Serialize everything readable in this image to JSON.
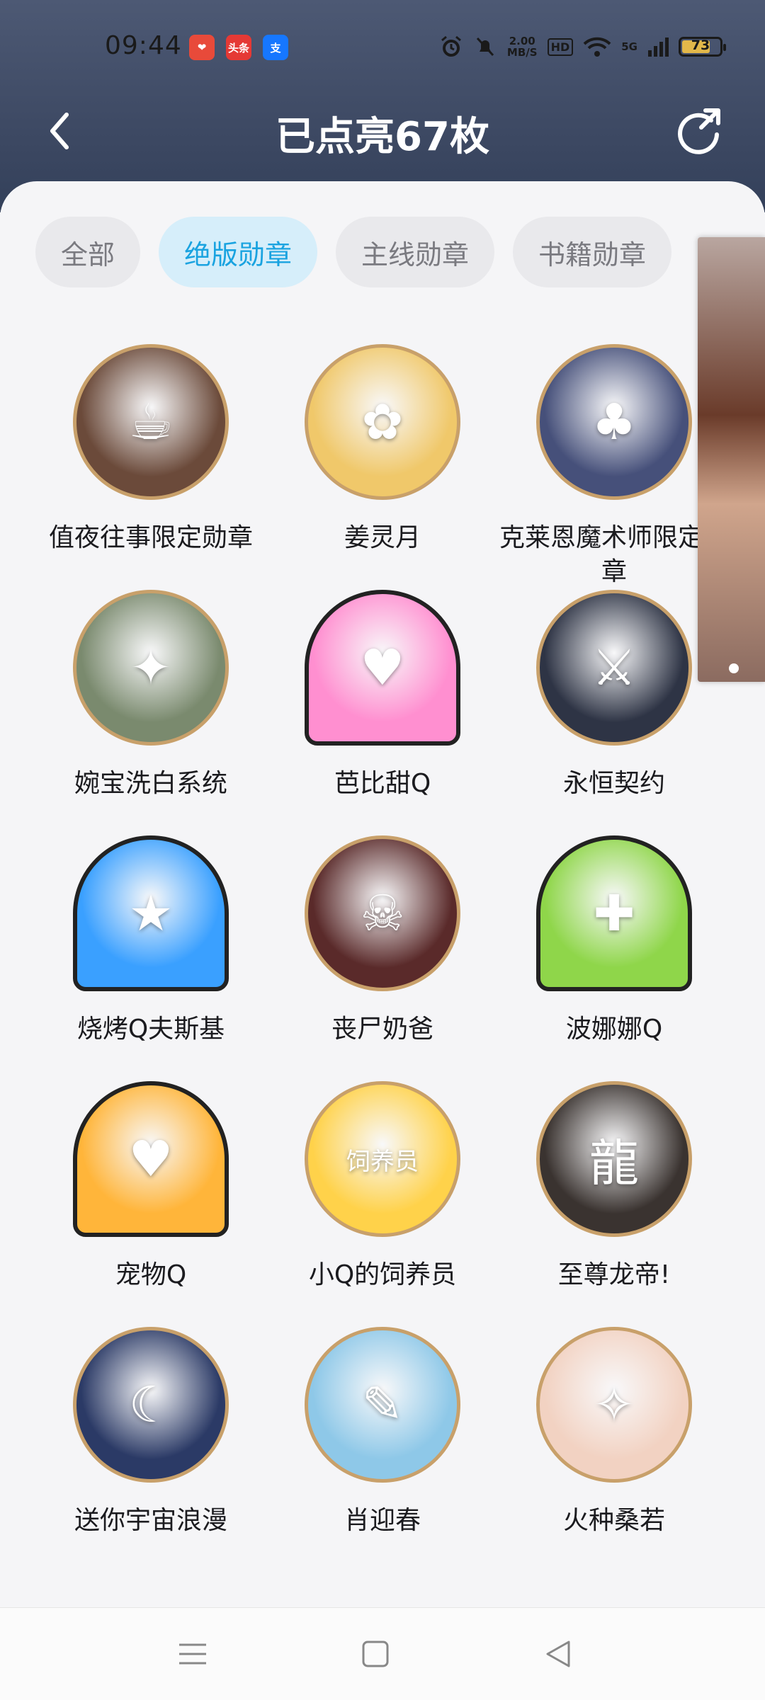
{
  "status_bar": {
    "time": "09:44",
    "apps": [
      {
        "name": "weather-app-icon",
        "text": "❤",
        "color": "#e84a3a"
      },
      {
        "name": "toutiao-app-icon",
        "text": "头条",
        "color": "#e53935"
      },
      {
        "name": "alipay-app-icon",
        "text": "支",
        "color": "#1677ff"
      }
    ],
    "net_speed_top": "2.00",
    "net_speed_bottom": "MB/S",
    "hd_label": "HD",
    "signal_label": "5G",
    "battery": "73"
  },
  "header": {
    "title": "已点亮67枚"
  },
  "tabs": [
    {
      "label": "全部",
      "active": false
    },
    {
      "label": "绝版勋章",
      "active": true
    },
    {
      "label": "主线勋章",
      "active": false
    },
    {
      "label": "书籍勋章",
      "active": false
    }
  ],
  "badges": [
    {
      "name": "值夜往事限定勋章",
      "glyph": "☕",
      "style": "circle",
      "bg": "#6b4a3a"
    },
    {
      "name": "姜灵月",
      "glyph": "✿",
      "style": "circle",
      "bg": "#f0c86a"
    },
    {
      "name": "克莱恩魔术师限定勋章",
      "glyph": "♣",
      "style": "circle",
      "bg": "#46507a"
    },
    {
      "name": "婉宝洗白系统",
      "glyph": "✦",
      "style": "circle",
      "bg": "#7a8a6e"
    },
    {
      "name": "芭比甜Q",
      "glyph": "♥",
      "style": "globe",
      "bg": "#ff8fd0"
    },
    {
      "name": "永恒契约",
      "glyph": "⚔",
      "style": "circle",
      "bg": "#2e3445"
    },
    {
      "name": "烧烤Q夫斯基",
      "glyph": "★",
      "style": "globe",
      "bg": "#3aa0ff"
    },
    {
      "name": "丧尸奶爸",
      "glyph": "☠",
      "style": "circle",
      "bg": "#5a2a2a"
    },
    {
      "name": "波娜娜Q",
      "glyph": "✚",
      "style": "globe",
      "bg": "#8fd64a"
    },
    {
      "name": "宠物Q",
      "glyph": "♥",
      "style": "globe",
      "bg": "#ffb53a"
    },
    {
      "name": "小Q的饲养员",
      "glyph": "饲养员",
      "style": "circle",
      "bg": "#ffd24a"
    },
    {
      "name": "至尊龙帝!",
      "glyph": "龍",
      "style": "circle",
      "bg": "#3a3330"
    },
    {
      "name": "送你宇宙浪漫",
      "glyph": "☾",
      "style": "circle",
      "bg": "#2b3a66"
    },
    {
      "name": "肖迎春",
      "glyph": "✎",
      "style": "circle",
      "bg": "#8ec8e8"
    },
    {
      "name": "火种桑若",
      "glyph": "✧",
      "style": "circle",
      "bg": "#f2d2c2"
    }
  ]
}
